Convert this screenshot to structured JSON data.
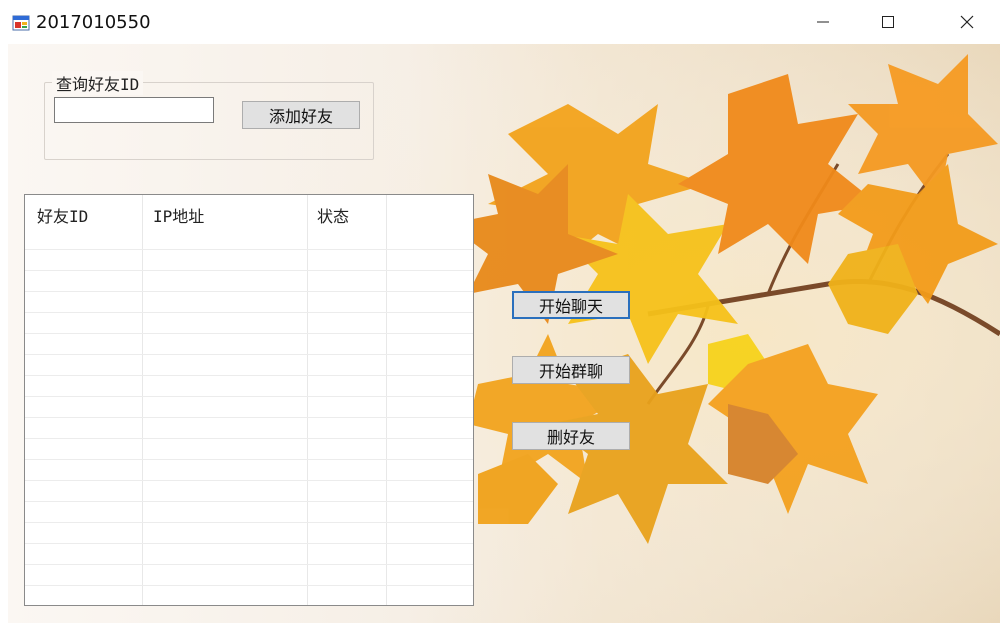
{
  "window": {
    "title": "2017010550"
  },
  "form": {
    "query_group_label": "查询好友ID",
    "search_input_value": "",
    "add_friend_button": "添加好友"
  },
  "table": {
    "columns": [
      "好友ID",
      "IP地址",
      "状态"
    ],
    "rows": []
  },
  "actions": {
    "start_chat": "开始聊天",
    "start_group_chat": "开始群聊",
    "delete_friend": "删好友"
  },
  "colors": {
    "focus_border": "#2a6fbd",
    "button_bg": "#e1e1e1",
    "leaf_orange": "#f29a1a",
    "leaf_yellow": "#f6c21a"
  }
}
